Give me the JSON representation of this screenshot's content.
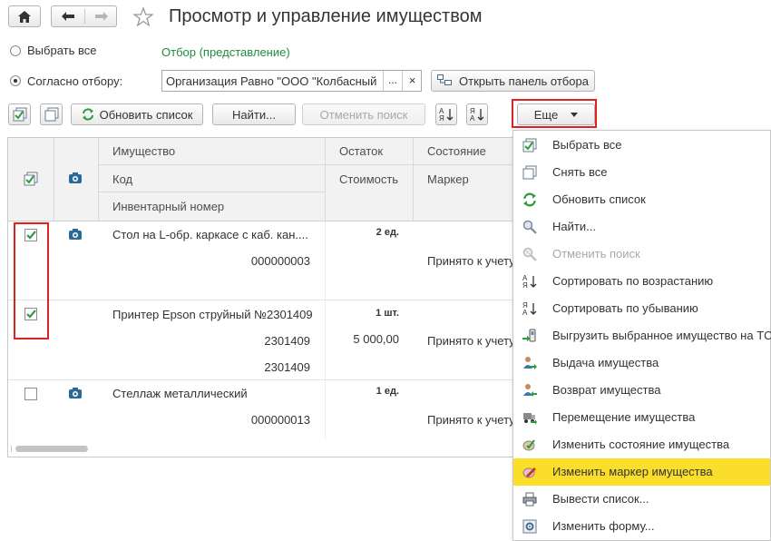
{
  "title": "Просмотр и управление имуществом",
  "filter": {
    "select_all_label": "Выбрать все",
    "according_label": "Согласно отбору:",
    "filter_link": "Отбор (представление)",
    "organization_value": "Организация Равно \"ООО \"Колбасный",
    "dots_label": "...",
    "clear_label": "×",
    "open_panel_label": "Открыть панель отбора"
  },
  "toolbar": {
    "refresh_label": "Обновить список",
    "find_label": "Найти...",
    "cancel_search_label": "Отменить поиск",
    "more_label": "Еще"
  },
  "table": {
    "headers": {
      "property": "Имущество",
      "code": "Код",
      "inventory_number": "Инвентарный номер",
      "balance": "Остаток",
      "cost": "Стоимость",
      "state": "Состояние",
      "marker": "Маркер"
    },
    "rows": [
      {
        "checked": true,
        "name": "Стол на L-обр. каркасе с каб. кан....",
        "code": "000000003",
        "inventory": "",
        "balance": "2 ед.",
        "cost": "",
        "state": "Принято к учету"
      },
      {
        "checked": true,
        "name": "Принтер Epson струйный №2301409",
        "code": "2301409",
        "inventory": "2301409",
        "balance": "1 шт.",
        "cost": "5 000,00",
        "state": "Принято к учету"
      },
      {
        "checked": false,
        "name": "Стеллаж металлический",
        "code": "000000013",
        "inventory": "",
        "balance": "1 ед.",
        "cost": "",
        "state": "Принято к учету"
      }
    ]
  },
  "menu": {
    "items": [
      {
        "label": "Выбрать все",
        "icon": "select-all-icon"
      },
      {
        "label": "Снять все",
        "icon": "deselect-all-icon"
      },
      {
        "label": "Обновить список",
        "icon": "refresh-icon"
      },
      {
        "label": "Найти...",
        "icon": "find-icon"
      },
      {
        "label": "Отменить поиск",
        "icon": "cancel-search-icon",
        "disabled": true
      },
      {
        "label": "Сортировать по возрастанию",
        "icon": "sort-asc-icon"
      },
      {
        "label": "Сортировать по убыванию",
        "icon": "sort-desc-icon"
      },
      {
        "label": "Выгрузить выбранное имущество на ТС",
        "icon": "export-tsd-icon"
      },
      {
        "label": "Выдача имущества",
        "icon": "issue-property-icon"
      },
      {
        "label": "Возврат имущества",
        "icon": "return-property-icon"
      },
      {
        "label": "Перемещение имущества",
        "icon": "move-property-icon"
      },
      {
        "label": "Изменить состояние имущества",
        "icon": "change-state-icon"
      },
      {
        "label": "Изменить маркер имущества",
        "icon": "change-marker-icon",
        "highlighted": true
      },
      {
        "label": "Вывести список...",
        "icon": "print-list-icon"
      },
      {
        "label": "Изменить форму...",
        "icon": "change-form-icon"
      }
    ]
  },
  "colors": {
    "highlight": "#fbde2a",
    "annotation_red": "#e0211d",
    "link_green": "#1f8d3a",
    "check_green": "#2e9b3e",
    "disabled_gray": "#a8a8a8"
  }
}
